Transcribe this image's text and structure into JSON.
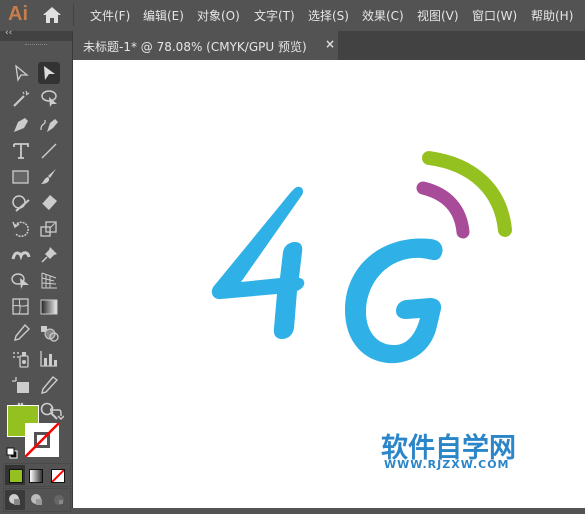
{
  "app": {
    "logo": "Ai"
  },
  "menu": [
    {
      "label": "文件(F)"
    },
    {
      "label": "编辑(E)"
    },
    {
      "label": "对象(O)"
    },
    {
      "label": "文字(T)"
    },
    {
      "label": "选择(S)"
    },
    {
      "label": "效果(C)"
    },
    {
      "label": "视图(V)"
    },
    {
      "label": "窗口(W)"
    },
    {
      "label": "帮助(H)"
    }
  ],
  "document_tab": {
    "title": "未标题-1* @ 78.08% (CMYK/GPU 预览)",
    "close": "×"
  },
  "toolbar": {
    "collapse": "‹‹"
  },
  "colors": {
    "fill": "#94c020",
    "logo_blue": "#2fb0e6",
    "logo_purple": "#a84c99",
    "logo_green": "#94c11f",
    "watermark": "#2a86c9"
  },
  "canvas": {
    "artwork": "4G",
    "watermark_cn": "软件自学网",
    "watermark_url": "WWW.RJZXW.COM"
  }
}
